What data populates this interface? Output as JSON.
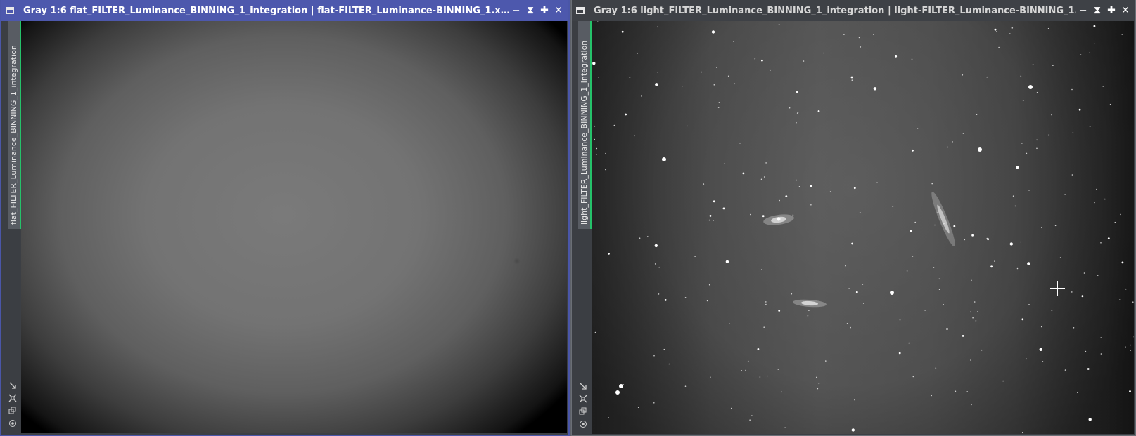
{
  "windows": [
    {
      "title": "Gray 1:6 flat_FILTER_Luminance_BINNING_1_integration | flat-FILTER_Luminance-BINNING_1.x…",
      "view_tab": "flat_FILTER_Luminance_BINNING_1_integration",
      "active": true
    },
    {
      "title": "Gray 1:6 light_FILTER_Luminance_BINNING_1_integration | light-FILTER_Luminance-BINNING_1…",
      "view_tab": "light_FILTER_Luminance_BINNING_1_integration",
      "active": false
    }
  ],
  "controls": {
    "minimize": "‒",
    "shade": "⧗",
    "maximize": "✚",
    "close": "✕"
  },
  "sidebar_tools": [
    "fit-view-icon",
    "zoom-to-fit-icon",
    "clone-icon",
    "identity-icon"
  ],
  "colors": {
    "active_title": "#4d58ad",
    "inactive_title": "#3e4146",
    "view_tab_accent": "#25c26a",
    "workspace": "#5e6269"
  }
}
